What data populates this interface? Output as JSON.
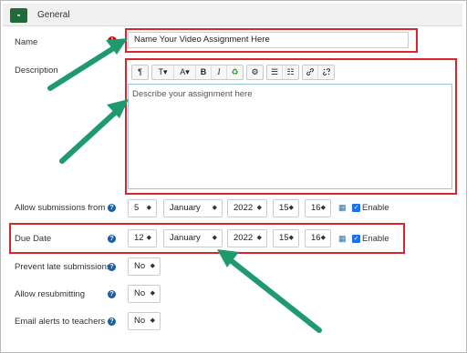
{
  "section": {
    "collapse_symbol": "-",
    "title": "General"
  },
  "fields": {
    "name_label": "Name",
    "name_value": "Name Your Video Assignment Here",
    "description_label": "Description",
    "description_placeholder": "Describe your assignment here",
    "allow_from_label": "Allow submissions from",
    "due_date_label": "Due Date",
    "prevent_late_label": "Prevent late submissions",
    "allow_resubmit_label": "Allow resubmitting",
    "email_alerts_label": "Email alerts to teachers"
  },
  "toolbar": {
    "btn_para": "¶",
    "btn_font": "T",
    "btn_color": "A",
    "btn_bold": "B",
    "btn_italic": "I",
    "btn_recycle": "♻",
    "btn_settings": "⚙",
    "btn_ul": "☰",
    "btn_ol": "☷",
    "btn_link": "🔗",
    "btn_unlink": "⛓"
  },
  "allow_from": {
    "day": "5",
    "month": "January",
    "year": "2022",
    "hour": "15",
    "minute": "16",
    "enable_label": "Enable"
  },
  "due_date": {
    "day": "12",
    "month": "January",
    "year": "2022",
    "hour": "15",
    "minute": "16",
    "enable_label": "Enable"
  },
  "prevent_late": {
    "value": "No"
  },
  "allow_resubmit": {
    "value": "No"
  },
  "email_alerts": {
    "value": "No"
  },
  "colors": {
    "highlight": "#d9262b",
    "arrow": "#1e9a6e",
    "accent": "#1f6b3a"
  }
}
